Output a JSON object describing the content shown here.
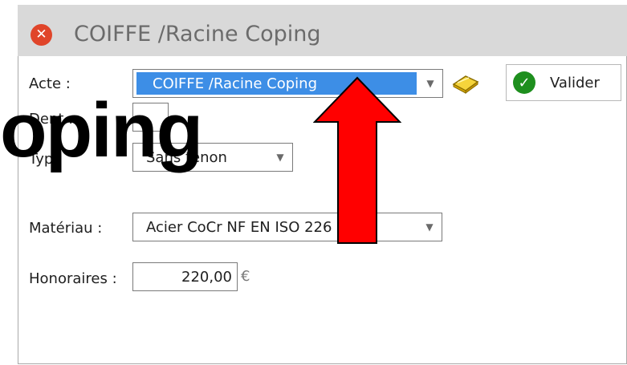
{
  "window": {
    "title": "COIFFE /Racine Coping",
    "close_glyph": "✕"
  },
  "form": {
    "acte": {
      "label": "Acte :",
      "value": "COIFFE /Racine Coping",
      "arrow": "▼"
    },
    "dent": {
      "label": "Dent :",
      "value": ""
    },
    "type": {
      "label": "Type",
      "value": "Sans tenon",
      "arrow": "▼"
    },
    "materiau": {
      "label": "Matériau :",
      "value": "Acier CoCr NF EN ISO 226",
      "arrow": "▼"
    },
    "honoraires": {
      "label": "Honoraires :",
      "value": "220,00",
      "currency": "€"
    }
  },
  "valider": {
    "label": "Valider",
    "check_glyph": "✓"
  },
  "overlay": {
    "text": "oping"
  },
  "colors": {
    "accent_blue": "#3d8ee6",
    "close_red": "#e0452a",
    "check_green": "#1e8f1e",
    "annotation_arrow": "#ff0000"
  }
}
